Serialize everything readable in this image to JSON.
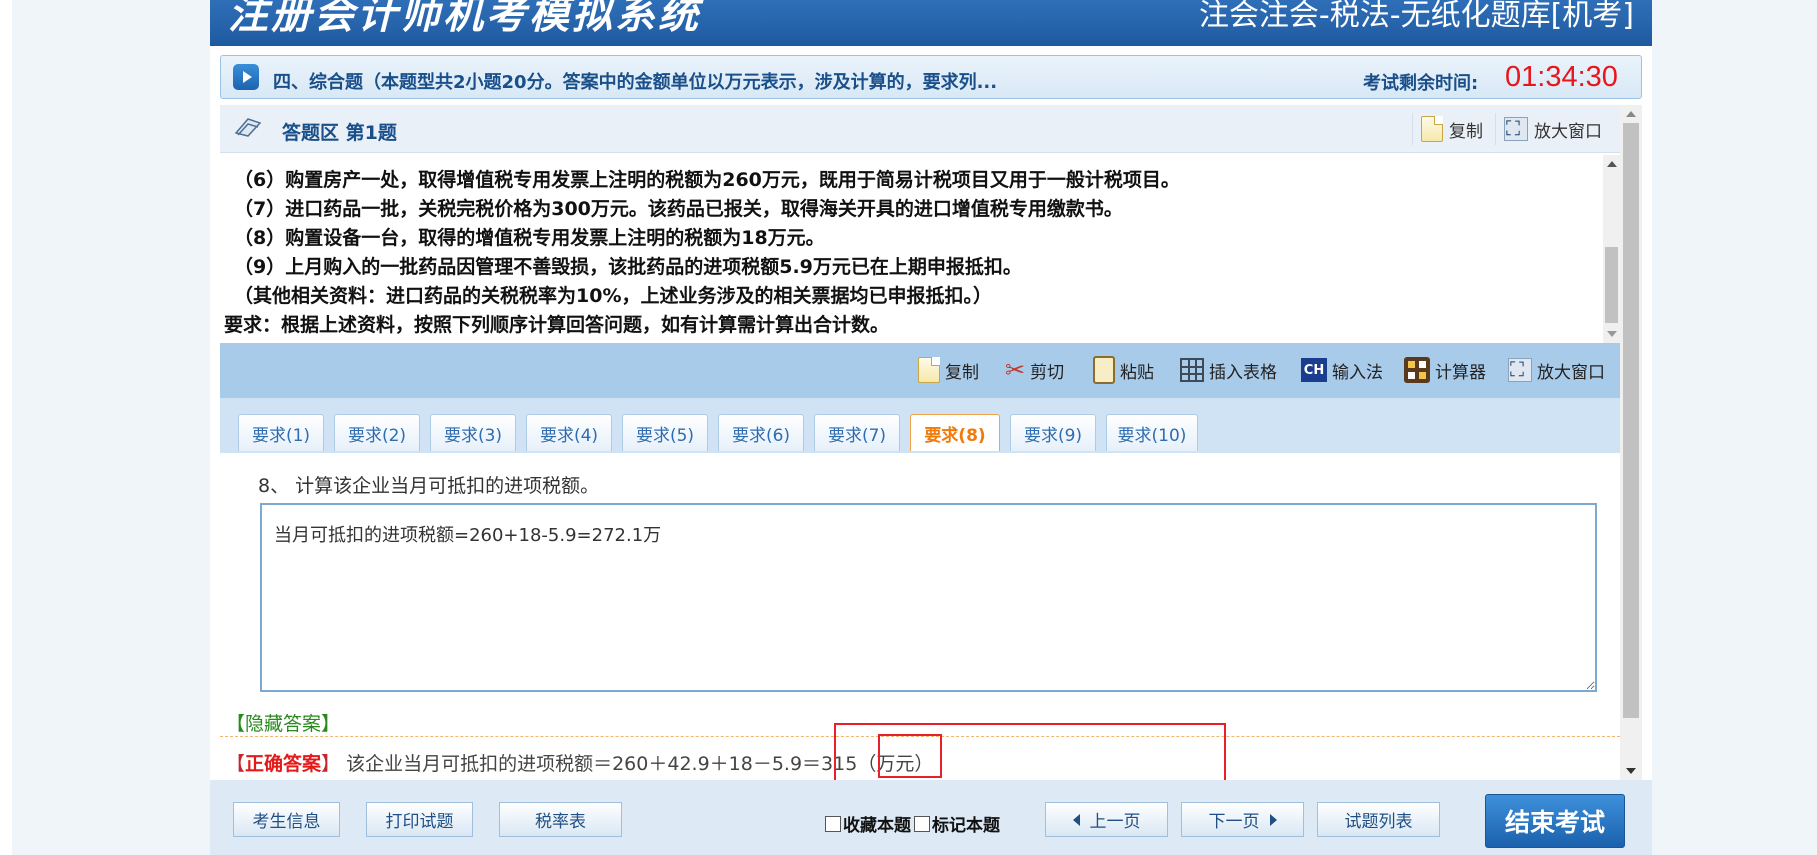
{
  "banner": {
    "system_title": "注册会计师机考模拟系统",
    "bank_title": "注会注会-税法-无纸化题库[机考]"
  },
  "section": {
    "text": "四、综合题（本题型共2小题20分。答案中的金额单位以万元表示，涉及计算的，要求列...",
    "timer_label": "考试剩余时间:",
    "timer_value": "01:34:30"
  },
  "answer_area": {
    "title": "答题区 第1题",
    "copy_label": "复制",
    "enlarge_label": "放大窗口"
  },
  "question_lines": [
    "（6）购置房产一处，取得增值税专用发票上注明的税额为260万元，既用于简易计税项目又用于一般计税项目。",
    "（7）进口药品一批，关税完税价格为300万元。该药品已报关，取得海关开具的进口增值税专用缴款书。",
    "（8）购置设备一台，取得的增值税专用发票上注明的税额为18万元。",
    "（9）上月购入的一批药品因管理不善毁损，该批药品的进项税额5.9万元已在上期申报抵扣。",
    "（其他相关资料：进口药品的关税税率为10%，上述业务涉及的相关票据均已申报抵扣。）",
    "要求：根据上述资料，按照下列顺序计算回答问题，如有计算需计算出合计数。"
  ],
  "editor_toolbar": {
    "copy": "复制",
    "cut": "剪切",
    "paste": "粘贴",
    "insert_table": "插入表格",
    "ime_icon_text": "CH",
    "ime": "输入法",
    "calculator": "计算器",
    "enlarge": "放大窗口"
  },
  "tabs": [
    "要求(1)",
    "要求(2)",
    "要求(3)",
    "要求(4)",
    "要求(5)",
    "要求(6)",
    "要求(7)",
    "要求(8)",
    "要求(9)",
    "要求(10)"
  ],
  "active_tab": "要求(8)",
  "requirement": {
    "prompt": "8、 计算该企业当月可抵扣的进项税额。",
    "answer_value": "当月可抵扣的进项税额=260+18-5.9=272.1万"
  },
  "hide_answer": "【隐藏答案】",
  "correct_answer": {
    "open_bracket": "【",
    "label": "正确答案",
    "close_bracket": "】",
    "text": " 该企业当月可抵扣的进项税额＝260＋42.9＋18－5.9＝315（万元）"
  },
  "bottom": {
    "candidate_info": "考生信息",
    "print": "打印试题",
    "tax_table": "税率表",
    "favorite": "收藏本题",
    "mark": "标记本题",
    "prev": "上一页",
    "next": "下一页",
    "list": "试题列表",
    "end_exam": "结束考试"
  },
  "colors": {
    "accent_blue": "#1f5aa0",
    "timer_red": "#e8161c",
    "active_tab_orange": "#f07a0a",
    "highlight_red": "#e8202a"
  }
}
